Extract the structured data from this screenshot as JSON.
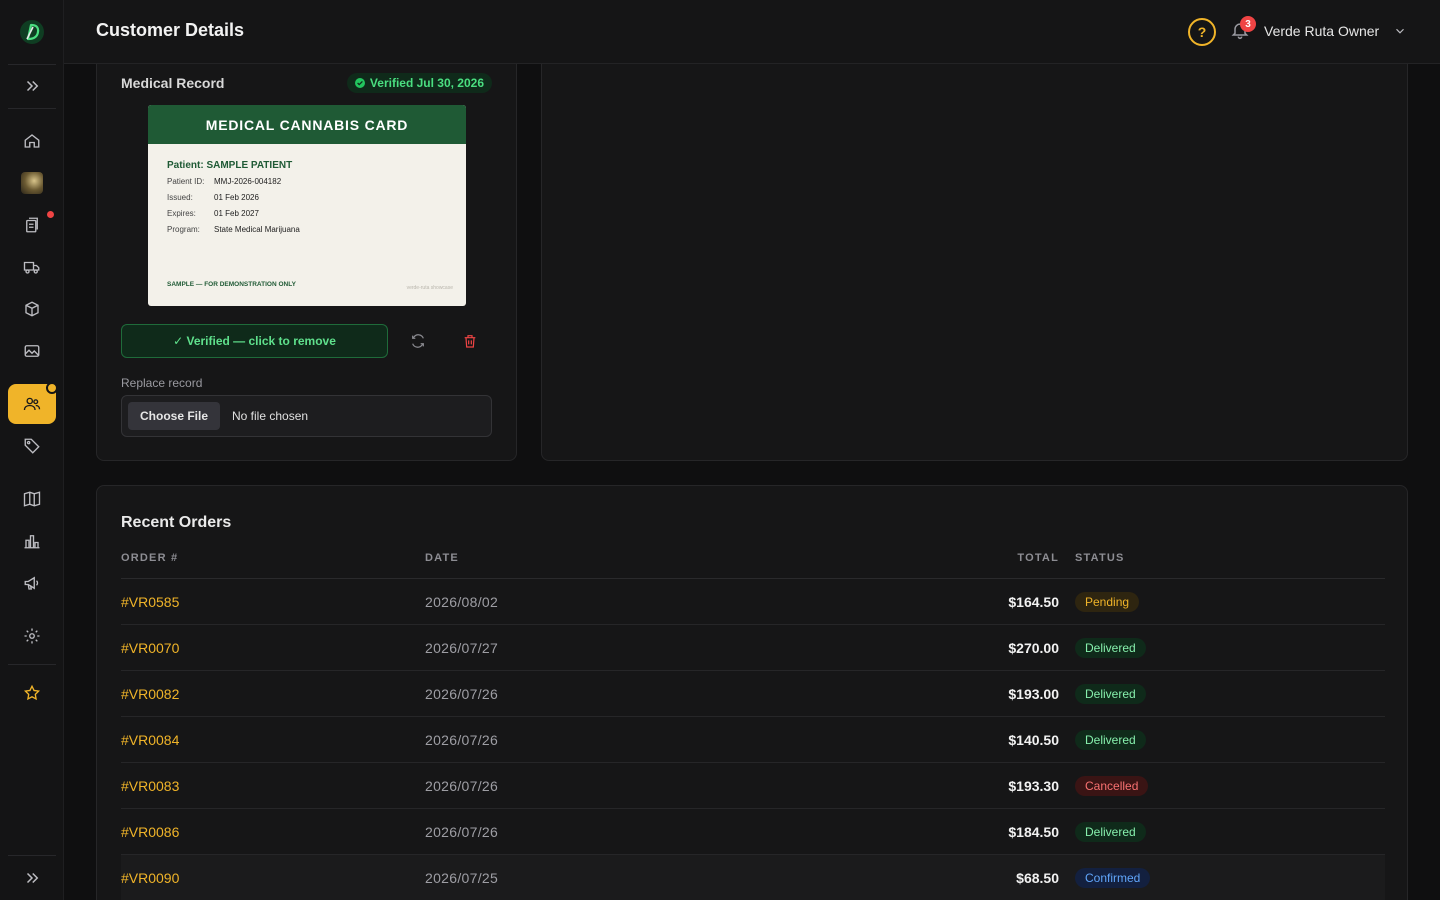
{
  "header": {
    "title": "Customer Details",
    "help_glyph": "?",
    "notifications_count": "3",
    "user_name": "Verde Ruta Owner"
  },
  "sidebar": {
    "items": [
      {
        "name": "home-icon"
      },
      {
        "name": "avatar"
      },
      {
        "name": "orders-icon"
      },
      {
        "name": "delivery-truck-icon"
      },
      {
        "name": "products-box-icon"
      },
      {
        "name": "media-image-icon"
      },
      {
        "name": "customers-icon",
        "active": true
      },
      {
        "name": "tag-icon"
      },
      {
        "name": "menu-book-icon"
      },
      {
        "name": "analytics-icon"
      },
      {
        "name": "marketing-megaphone-icon"
      },
      {
        "name": "settings-gear-icon"
      },
      {
        "name": "star-icon"
      }
    ]
  },
  "medical_record": {
    "title": "Medical Record",
    "verified_label": "Verified Jul 30, 2026",
    "card": {
      "heading": "MEDICAL CANNABIS CARD",
      "patient": "Patient: SAMPLE PATIENT",
      "rows": [
        {
          "k": "Patient ID:",
          "v": "MMJ-2026-004182"
        },
        {
          "k": "Issued:",
          "v": "01 Feb 2026"
        },
        {
          "k": "Expires:",
          "v": "01 Feb 2027"
        },
        {
          "k": "Program:",
          "v": "State Medical Marijuana"
        }
      ],
      "footer": "SAMPLE — FOR DEMONSTRATION ONLY",
      "watermark": "verde-ruta showcase"
    },
    "verify_button": "✓ Verified — click to remove",
    "replace_label": "Replace record",
    "choose_file": "Choose File",
    "no_file": "No file chosen"
  },
  "orders": {
    "title": "Recent Orders",
    "columns": {
      "order": "ORDER #",
      "date": "DATE",
      "total": "TOTAL",
      "status": "STATUS"
    },
    "rows": [
      {
        "order": "#VR0585",
        "date": "2026/08/02",
        "total": "$164.50",
        "status": "Pending"
      },
      {
        "order": "#VR0070",
        "date": "2026/07/27",
        "total": "$270.00",
        "status": "Delivered"
      },
      {
        "order": "#VR0082",
        "date": "2026/07/26",
        "total": "$193.00",
        "status": "Delivered"
      },
      {
        "order": "#VR0084",
        "date": "2026/07/26",
        "total": "$140.50",
        "status": "Delivered"
      },
      {
        "order": "#VR0083",
        "date": "2026/07/26",
        "total": "$193.30",
        "status": "Cancelled"
      },
      {
        "order": "#VR0086",
        "date": "2026/07/26",
        "total": "$184.50",
        "status": "Delivered"
      },
      {
        "order": "#VR0090",
        "date": "2026/07/25",
        "total": "$68.50",
        "status": "Confirmed"
      }
    ]
  },
  "colors": {
    "accent": "#f0b429",
    "success": "#4ade80",
    "danger": "#ef4444",
    "status": {
      "Pending": {
        "bg": "#2e2510",
        "fg": "#f0b429"
      },
      "Delivered": {
        "bg": "#0f2a1a",
        "fg": "#86efac"
      },
      "Cancelled": {
        "bg": "#3a1414",
        "fg": "#f87171"
      },
      "Confirmed": {
        "bg": "#13203f",
        "fg": "#60a5fa"
      }
    }
  }
}
